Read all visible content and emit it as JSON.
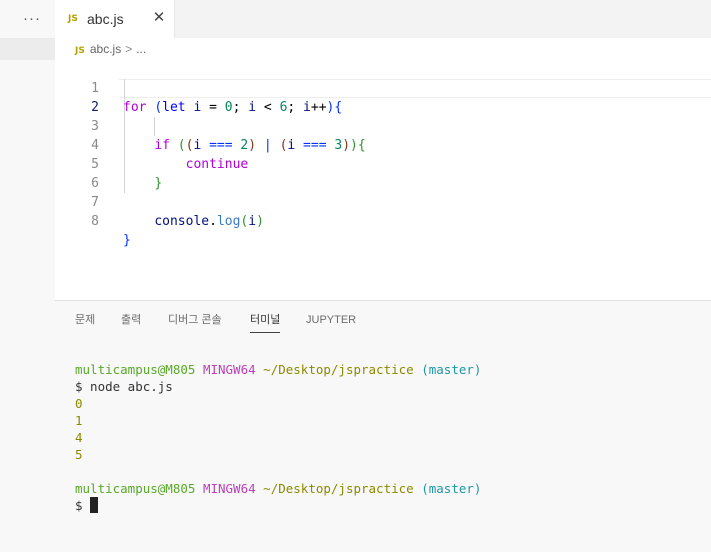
{
  "tabs": {
    "more_label": "···",
    "file_tab": {
      "badge": "JS",
      "label": "abc.js",
      "close": "✕"
    }
  },
  "breadcrumb": {
    "badge": "JS",
    "file": "abc.js",
    "separator": ">",
    "rest": "..."
  },
  "editor": {
    "line_numbers": [
      "1",
      "2",
      "3",
      "4",
      "5",
      "6",
      "7",
      "8"
    ],
    "active_line": "2"
  },
  "panel": {
    "tabs": [
      {
        "label": "문제"
      },
      {
        "label": "출력"
      },
      {
        "label": "디버그 콘솔"
      },
      {
        "label": "터미널"
      },
      {
        "label": "JUPYTER"
      }
    ],
    "active_tab": "터미널"
  },
  "terminal": {
    "user": "multicampus@M805",
    "env": "MINGW64",
    "path": "~/Desktop/jspractice",
    "branch": "(master)",
    "command": "$ node abc.js",
    "outputs": [
      "0",
      "1",
      "4",
      "5"
    ],
    "prompt": "$"
  },
  "colors": {
    "keyword": "#af00db",
    "keyword_blue": "#0000ff",
    "number": "#098658",
    "function": "#795e26",
    "variable": "#001080",
    "terminal_user": "#5aa82a",
    "terminal_env": "#bc3fbc",
    "terminal_path": "#8a8a00",
    "terminal_branch": "#1e96a8"
  }
}
